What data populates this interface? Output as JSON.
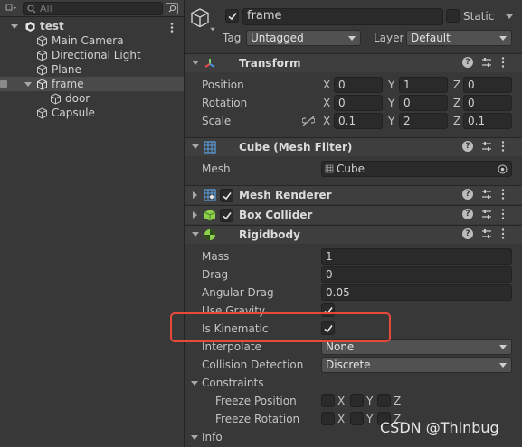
{
  "hierarchy": {
    "search_placeholder": "All",
    "scene": "test",
    "items": [
      {
        "label": "Main Camera"
      },
      {
        "label": "Directional Light"
      },
      {
        "label": "Plane"
      },
      {
        "label": "frame"
      },
      {
        "label": "door"
      },
      {
        "label": "Capsule"
      }
    ]
  },
  "inspector": {
    "object_name": "frame",
    "static_label": "Static",
    "tag_label": "Tag",
    "tag_value": "Untagged",
    "layer_label": "Layer",
    "layer_value": "Default",
    "transform": {
      "title": "Transform",
      "position_label": "Position",
      "rotation_label": "Rotation",
      "scale_label": "Scale",
      "axes": [
        "X",
        "Y",
        "Z"
      ],
      "position": [
        "0",
        "1",
        "0"
      ],
      "rotation": [
        "0",
        "0",
        "0"
      ],
      "scale": [
        "0.1",
        "2",
        "0.1"
      ]
    },
    "mesh_filter": {
      "title": "Cube (Mesh Filter)",
      "mesh_label": "Mesh",
      "mesh_value": "Cube"
    },
    "mesh_renderer": {
      "title": "Mesh Renderer"
    },
    "box_collider": {
      "title": "Box Collider"
    },
    "rigidbody": {
      "title": "Rigidbody",
      "mass_label": "Mass",
      "mass": "1",
      "drag_label": "Drag",
      "drag": "0",
      "angular_drag_label": "Angular Drag",
      "angular_drag": "0.05",
      "use_gravity_label": "Use Gravity",
      "is_kinematic_label": "Is Kinematic",
      "interpolate_label": "Interpolate",
      "interpolate": "None",
      "collision_label": "Collision Detection",
      "collision": "Discrete",
      "constraints_label": "Constraints",
      "freeze_position_label": "Freeze Position",
      "freeze_rotation_label": "Freeze Rotation",
      "info_label": "Info"
    }
  },
  "watermark": "CSDN @Thinbug",
  "colors": {
    "highlight": "#e8493d",
    "transform_x": "#e54b4b",
    "transform_y": "#7bd36f",
    "transform_z": "#4b8de5",
    "collider_green": "#8bd14b"
  }
}
